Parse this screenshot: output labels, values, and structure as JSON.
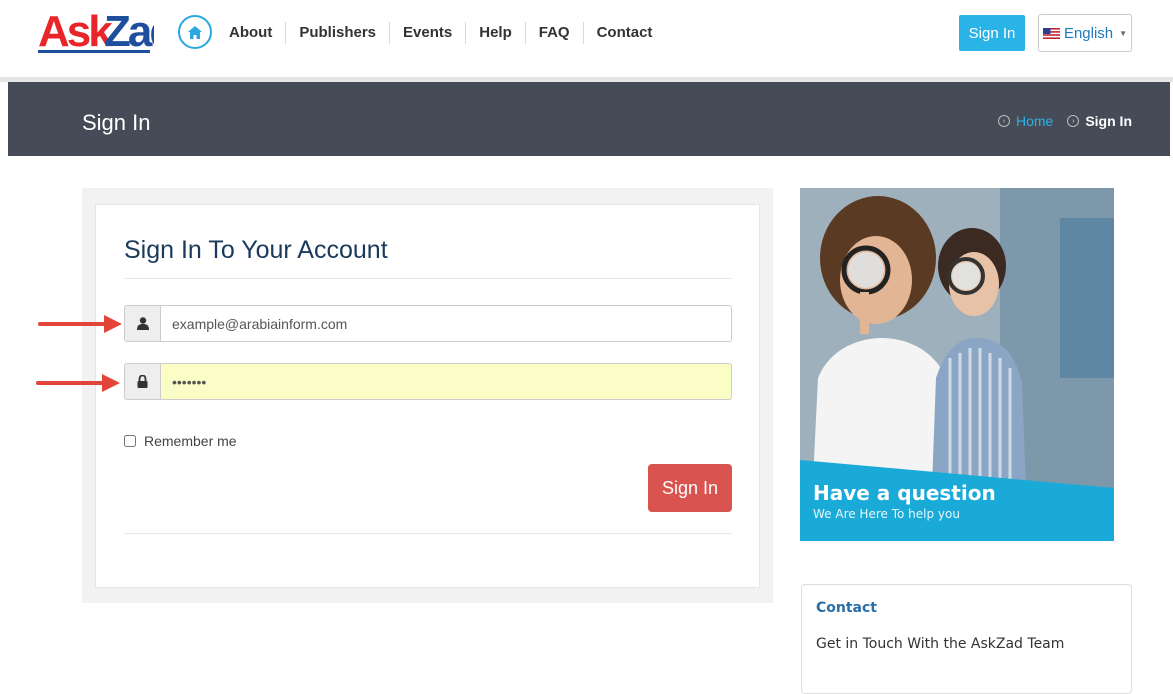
{
  "header": {
    "logo_text": "AskZad",
    "nav": [
      "About",
      "Publishers",
      "Events",
      "Help",
      "FAQ",
      "Contact"
    ],
    "signin_label": "Sign In",
    "language_label": "English",
    "icons": {
      "home": "home-icon",
      "flag": "us-flag-icon",
      "caret": "caret-down-icon"
    }
  },
  "page": {
    "title": "Sign In",
    "breadcrumb": {
      "home": "Home",
      "current": "Sign In"
    }
  },
  "form": {
    "heading": "Sign In To Your Account",
    "username_value": "example@arabiainform.com",
    "password_value": "•••••••",
    "remember_label": "Remember me",
    "remember_checked": false,
    "submit_label": "Sign In",
    "icons": {
      "user": "user-icon",
      "lock": "lock-icon"
    }
  },
  "promo": {
    "title": "Have a question",
    "subtitle": "We Are Here To help you"
  },
  "contact": {
    "title": "Contact",
    "text": "Get in Touch With the AskZad Team"
  },
  "colors": {
    "brand_blue": "#2ab3e6",
    "title_bar": "#464b58",
    "submit_red": "#d9534f",
    "arrow_red": "#e2443a",
    "logo_red": "#e8262a",
    "logo_blue": "#1d4f9c"
  }
}
